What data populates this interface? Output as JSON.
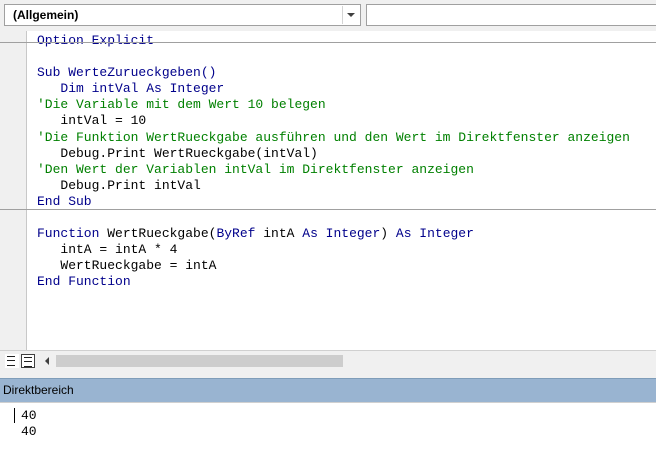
{
  "toolbar": {
    "object_select": "(Allgemein)",
    "procedure_select": ""
  },
  "code": {
    "lines": [
      [
        {
          "t": "Option Explicit",
          "c": "kw"
        }
      ],
      [],
      [
        {
          "t": "Sub ",
          "c": "kw"
        },
        {
          "t": "WerteZurueckgeben()",
          "c": "kw"
        }
      ],
      [
        {
          "t": "   Dim ",
          "c": "kw"
        },
        {
          "t": "intVal ",
          "c": "kw"
        },
        {
          "t": "As Integer",
          "c": "kw"
        }
      ],
      [
        {
          "t": "'Die Variable mit dem Wert 10 belegen",
          "c": "cm"
        }
      ],
      [
        {
          "t": "   intVal = 10",
          "c": "tx"
        }
      ],
      [
        {
          "t": "'Die Funktion WertRueckgabe ausführen und den Wert im Direktfenster anzeigen",
          "c": "cm"
        }
      ],
      [
        {
          "t": "   Debug.Print WertRueckgabe(intVal)",
          "c": "tx"
        }
      ],
      [
        {
          "t": "'Den Wert der Variablen intVal im Direktfenster anzeigen",
          "c": "cm"
        }
      ],
      [
        {
          "t": "   Debug.Print intVal",
          "c": "tx"
        }
      ],
      [
        {
          "t": "End Sub",
          "c": "kw"
        }
      ],
      [],
      [
        {
          "t": "Function ",
          "c": "kw"
        },
        {
          "t": "WertRueckgabe(",
          "c": "tx"
        },
        {
          "t": "ByRef ",
          "c": "kw"
        },
        {
          "t": "intA ",
          "c": "tx"
        },
        {
          "t": "As Integer",
          "c": "kw"
        },
        {
          "t": ") ",
          "c": "tx"
        },
        {
          "t": "As Integer",
          "c": "kw"
        }
      ],
      [
        {
          "t": "   intA = intA * 4",
          "c": "tx"
        }
      ],
      [
        {
          "t": "   WertRueckgabe = intA",
          "c": "tx"
        }
      ],
      [
        {
          "t": "End Function",
          "c": "kw"
        }
      ]
    ]
  },
  "immediate": {
    "title": "Direktbereich",
    "output": [
      "40",
      "40"
    ]
  },
  "colors": {
    "keyword": "#00008b",
    "comment": "#008000",
    "title_bar": "#99b4d1"
  }
}
